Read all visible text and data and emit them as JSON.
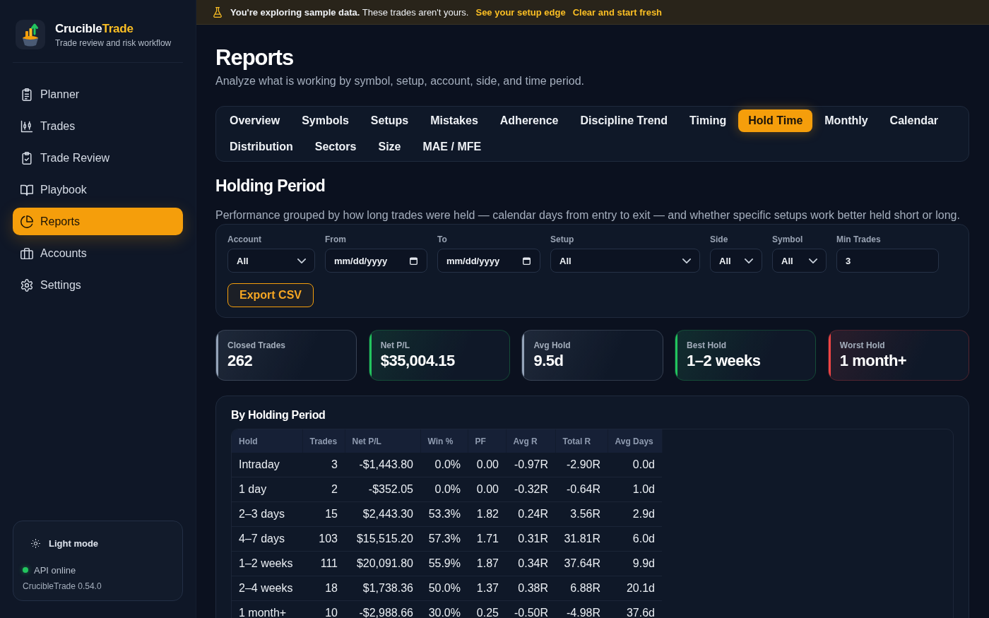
{
  "sidebar": {
    "brand": {
      "name_parts": [
        "Crucible",
        "Trade"
      ],
      "tagline": "Trade review and risk workflow"
    },
    "nav": [
      {
        "label": "Planner",
        "selected": false
      },
      {
        "label": "Trades",
        "selected": false
      },
      {
        "label": "Trade Review",
        "selected": false
      },
      {
        "label": "Playbook",
        "selected": false
      },
      {
        "label": "Reports",
        "selected": true
      },
      {
        "label": "Accounts",
        "selected": false
      },
      {
        "label": "Settings",
        "selected": false
      }
    ],
    "theme_toggle": "Light mode",
    "status": {
      "label": "API online",
      "online": true
    },
    "version": "CrucibleTrade 0.54.0"
  },
  "banner": {
    "message": "**You're exploring sample data.** These trades aren't yours.",
    "links": [
      "See your setup edge",
      "Clear and start fresh"
    ]
  },
  "page": {
    "title": "Reports",
    "subtitle": "Analyze what is working by symbol, setup, account, side, and time period."
  },
  "tabs": [
    {
      "label": "Overview",
      "selected": false
    },
    {
      "label": "Symbols",
      "selected": false
    },
    {
      "label": "Setups",
      "selected": false
    },
    {
      "label": "Mistakes",
      "selected": false
    },
    {
      "label": "Adherence",
      "selected": false
    },
    {
      "label": "Discipline Trend",
      "selected": false
    },
    {
      "label": "Timing",
      "selected": false
    },
    {
      "label": "Hold Time",
      "selected": true
    },
    {
      "label": "Monthly",
      "selected": false
    },
    {
      "label": "Calendar",
      "selected": false
    },
    {
      "label": "Distribution",
      "selected": false
    },
    {
      "label": "Sectors",
      "selected": false
    },
    {
      "label": "Size",
      "selected": false
    },
    {
      "label": "MAE / MFE",
      "selected": false
    }
  ],
  "section": {
    "title": "Holding Period",
    "description": "Performance grouped by how long trades were held — calendar days from entry to exit — and whether specific setups work better held short or long."
  },
  "filters": {
    "fields": [
      {
        "label": "Account",
        "kind": "select",
        "value": "All"
      },
      {
        "label": "From",
        "kind": "date",
        "placeholder": "mm/dd/yyyy"
      },
      {
        "label": "To",
        "kind": "date",
        "placeholder": "mm/dd/yyyy"
      },
      {
        "label": "Setup",
        "kind": "select",
        "value": "All"
      },
      {
        "label": "Side",
        "kind": "select",
        "value": "All"
      },
      {
        "label": "Symbol",
        "kind": "select",
        "value": "All"
      },
      {
        "label": "Min Trades",
        "kind": "number",
        "value": "3"
      }
    ],
    "export_button": "Export CSV"
  },
  "stats": [
    {
      "label": "Closed Trades",
      "value": "262",
      "color": "#94a3b8"
    },
    {
      "label": "Net P/L",
      "value": "$35,004.15",
      "color": "#22c55e"
    },
    {
      "label": "Avg Hold",
      "value": "9.5d",
      "color": "#94a3b8"
    },
    {
      "label": "Best Hold",
      "value": "1–2 weeks",
      "color": "#22c55e"
    },
    {
      "label": "Worst Hold",
      "value": "1 month+",
      "color": "#ef4444"
    }
  ],
  "table": {
    "title": "By Holding Period",
    "columns": [
      "Hold",
      "Trades",
      "Net P/L",
      "Win %",
      "PF",
      "Avg R",
      "Total R",
      "Avg Days"
    ],
    "rows": [
      [
        "Intraday",
        "3",
        "-$1,443.80",
        "0.0%",
        "0.00",
        "-0.97R",
        "-2.90R",
        "0.0d"
      ],
      [
        "1 day",
        "2",
        "-$352.05",
        "0.0%",
        "0.00",
        "-0.32R",
        "-0.64R",
        "1.0d"
      ],
      [
        "2–3 days",
        "15",
        "$2,443.30",
        "53.3%",
        "1.82",
        "0.24R",
        "3.56R",
        "2.9d"
      ],
      [
        "4–7 days",
        "103",
        "$15,515.20",
        "57.3%",
        "1.71",
        "0.31R",
        "31.81R",
        "6.0d"
      ],
      [
        "1–2 weeks",
        "111",
        "$20,091.80",
        "55.9%",
        "1.87",
        "0.34R",
        "37.64R",
        "9.9d"
      ],
      [
        "2–4 weeks",
        "18",
        "$1,738.36",
        "50.0%",
        "1.37",
        "0.38R",
        "6.88R",
        "20.1d"
      ],
      [
        "1 month+",
        "10",
        "-$2,988.66",
        "30.0%",
        "0.25",
        "-0.50R",
        "-4.98R",
        "37.6d"
      ]
    ]
  }
}
